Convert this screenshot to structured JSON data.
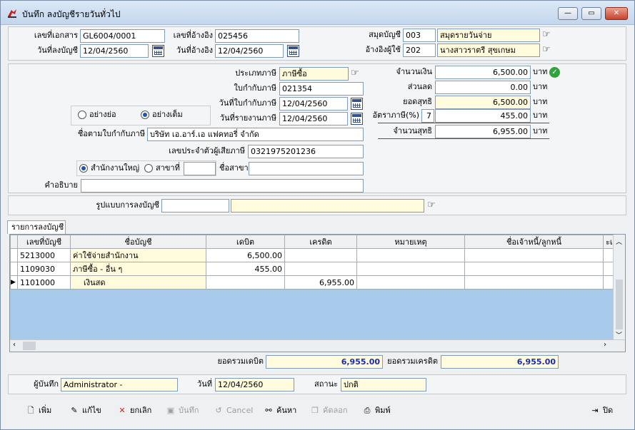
{
  "window": {
    "title": "บันทึก ลงบัญชีรายวันทั่วไป",
    "min": "—",
    "max": "▭",
    "close": "✕"
  },
  "header": {
    "doc_no_label": "เลขที่เอกสาร",
    "doc_no": "GL6004/0001",
    "ref_no_label": "เลขที่อ้างอิง",
    "ref_no": "025456",
    "book_label": "สมุดบัญชี",
    "book_code": "003",
    "book_name": "สมุดรายวันจ่าย",
    "post_date_label": "วันที่ลงบัญชี",
    "post_date": "12/04/2560",
    "ref_date_label": "วันที่อ้างอิง",
    "ref_date": "12/04/2560",
    "ref_person_label": "อ้างอิงผู้ใช้",
    "ref_person_code": "202",
    "ref_person_name": "นางสาวราตรี สุขเกษม"
  },
  "tax": {
    "type_label": "ประเภทภาษี",
    "type": "ภาษีซื้อ",
    "invoice_label": "ใบกำกับภาษี",
    "invoice": "021354",
    "invoice_date_label": "วันที่ใบกำกับภาษี",
    "invoice_date": "12/04/2560",
    "report_date_label": "วันที่รายงานภาษี",
    "report_date": "12/04/2560",
    "radio_short": "อย่างย่อ",
    "radio_full": "อย่างเต็ม",
    "name_label": "ชื่อตามใบกำกับภาษี",
    "name": "บริษัท เอ.อาร์.เอ แฟคทอรี่ จำกัด",
    "taxid_label": "เลขประจำตัวผู้เสียภาษี",
    "taxid": "0321975201236",
    "hq_label": "สำนักงานใหญ่",
    "branch_label": "สาขาที่",
    "branch_no": "",
    "branch_name_label": "ชื่อสาขา",
    "branch_name": ""
  },
  "amounts": {
    "amount_label": "จำนวนเงิน",
    "amount": "6,500.00",
    "unit": "บาท",
    "discount_label": "ส่วนลด",
    "discount": "0.00",
    "net_label": "ยอดสุทธิ",
    "net": "6,500.00",
    "vat_label": "อัตราภาษี(%)",
    "vat_rate": "7",
    "vat": "455.00",
    "total_label": "จำนวนสุทธิ",
    "total": "6,955.00"
  },
  "description": {
    "label": "คำอธิบาย",
    "value": ""
  },
  "template": {
    "label": "รูปแบบการลงบัญชี",
    "code": "",
    "name": ""
  },
  "entries": {
    "tab": "รายการลงบัญชี",
    "columns": [
      "เลขที่บัญชี",
      "ชื่อบัญชี",
      "เดบิต",
      "เครดิต",
      "หมายเหตุ",
      "ชื่อเจ้าหนี้/ลูกหนี้",
      "ะเ"
    ],
    "rows": [
      {
        "acct": "5213000",
        "name": "ค่าใช้จ่ายสำนักงาน",
        "debit": "6,500.00",
        "credit": "",
        "note": "",
        "party": ""
      },
      {
        "acct": "1109030",
        "name": "ภาษีซื้อ - อื่น ๆ",
        "debit": "455.00",
        "credit": "",
        "note": "",
        "party": ""
      },
      {
        "acct": "1101000",
        "name": "เงินสด",
        "debit": "",
        "credit": "6,955.00",
        "note": "",
        "party": ""
      }
    ],
    "total_debit_label": "ยอดรวมเดบิต",
    "total_debit": "6,955.00",
    "total_credit_label": "ยอดรวมเครดิต",
    "total_credit": "6,955.00"
  },
  "footer": {
    "user_label": "ผู้บันทึก",
    "user": "Administrator -",
    "date_label": "วันที่",
    "date": "12/04/2560",
    "status_label": "สถานะ",
    "status": "ปกติ"
  },
  "toolbar": {
    "add": "เพิ่ม",
    "edit": "แก้ไข",
    "cancel_doc": "ยกเลิก",
    "save": "บันทึก",
    "cancel": "Cancel",
    "search": "ค้นหา",
    "copy": "คัดลอก",
    "print": "พิมพ์",
    "close": "ปิด"
  },
  "colors": {
    "yellow_field": "#fffbdc",
    "grid_bg": "#a7c9ea",
    "total_blue": "#1a2bb0"
  }
}
